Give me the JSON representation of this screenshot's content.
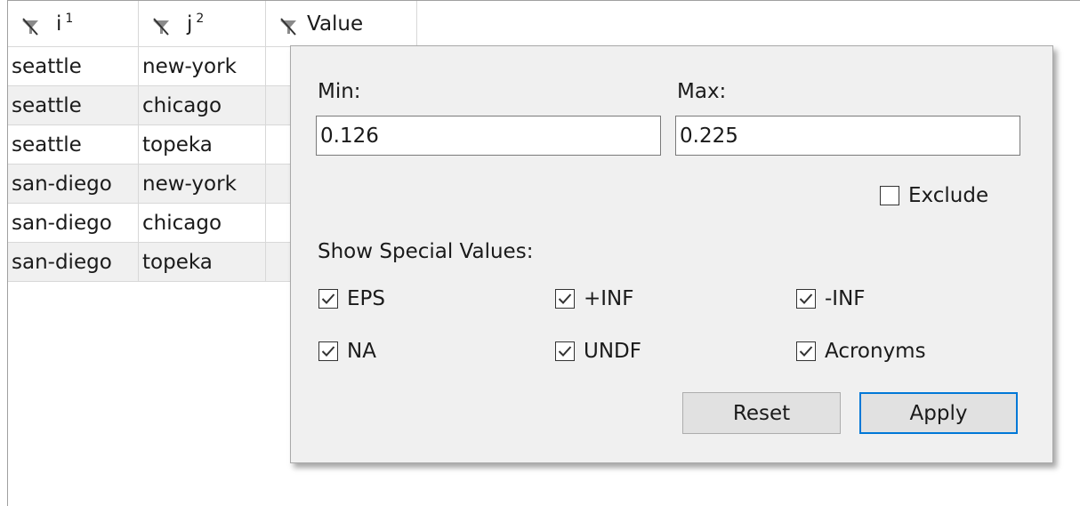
{
  "table": {
    "headers": [
      {
        "name": "i",
        "sup": "1"
      },
      {
        "name": "j",
        "sup": "2"
      },
      {
        "name": "Value",
        "sup": ""
      }
    ],
    "rows": [
      [
        "seattle",
        "new-york"
      ],
      [
        "seattle",
        "chicago"
      ],
      [
        "seattle",
        "topeka"
      ],
      [
        "san-diego",
        "new-york"
      ],
      [
        "san-diego",
        "chicago"
      ],
      [
        "san-diego",
        "topeka"
      ]
    ]
  },
  "filter": {
    "min_label": "Min:",
    "max_label": "Max:",
    "min_value": "0.126",
    "max_value": "0.225",
    "exclude_label": "Exclude",
    "exclude_checked": false,
    "special_values_label": "Show Special Values:",
    "options": {
      "eps": {
        "label": "EPS",
        "checked": true
      },
      "pinf": {
        "label": "+INF",
        "checked": true
      },
      "minf": {
        "label": "-INF",
        "checked": true
      },
      "na": {
        "label": "NA",
        "checked": true
      },
      "undf": {
        "label": "UNDF",
        "checked": true
      },
      "acronyms": {
        "label": "Acronyms",
        "checked": true
      }
    },
    "reset_label": "Reset",
    "apply_label": "Apply"
  },
  "colors": {
    "accent": "#0078d7",
    "popup_bg": "#f0f0f0",
    "alt_row": "#f0f0f0"
  }
}
